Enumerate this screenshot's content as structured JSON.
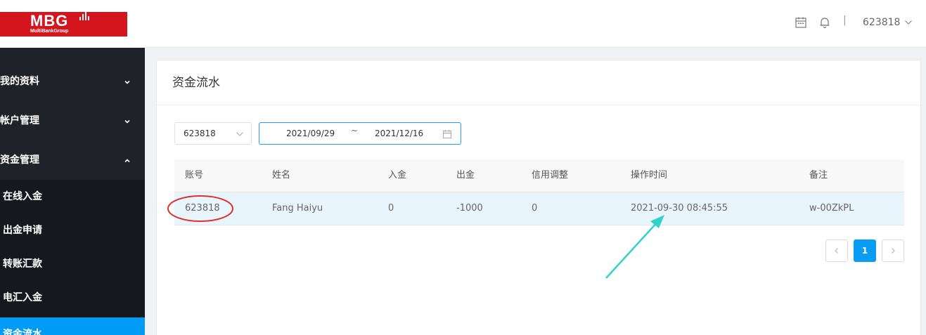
{
  "brand": {
    "logo_text": "MBG",
    "logo_subtext": "MultiBankGroup",
    "color": "#d5151d"
  },
  "sidebar": {
    "parents": [
      {
        "label": "我的资料",
        "expanded": false
      },
      {
        "label": "帐户管理",
        "expanded": false
      },
      {
        "label": "资金管理",
        "expanded": true
      }
    ],
    "children": [
      {
        "label": "在线入金",
        "active": false
      },
      {
        "label": "出金申请",
        "active": false
      },
      {
        "label": "转账汇款",
        "active": false
      },
      {
        "label": "电汇入金",
        "active": false
      },
      {
        "label": "资金流水",
        "active": true
      }
    ]
  },
  "header": {
    "icons": [
      "calendar-icon",
      "bell-icon"
    ],
    "separator": "|",
    "user": "623818"
  },
  "panel": {
    "title": "资金流水",
    "filters": {
      "account_select": "623818",
      "date_start": "2021/09/29",
      "date_sep": "~",
      "date_end": "2021/12/16"
    },
    "table": {
      "columns": [
        "账号",
        "姓名",
        "入金",
        "出金",
        "信用调整",
        "操作时间",
        "备注"
      ],
      "rows": [
        [
          "623818",
          "Fang Haiyu",
          "0",
          "-1000",
          "0",
          "2021-09-30 08:45:55",
          "w-00ZkPL"
        ]
      ]
    },
    "pagination": {
      "current": "1"
    }
  },
  "colors": {
    "accent": "#009bf5",
    "sidebar_bg": "#20222a",
    "highlight_row": "#e8f5fd",
    "annotation_red": "#e0302e",
    "annotation_teal": "#2fd3c9"
  }
}
